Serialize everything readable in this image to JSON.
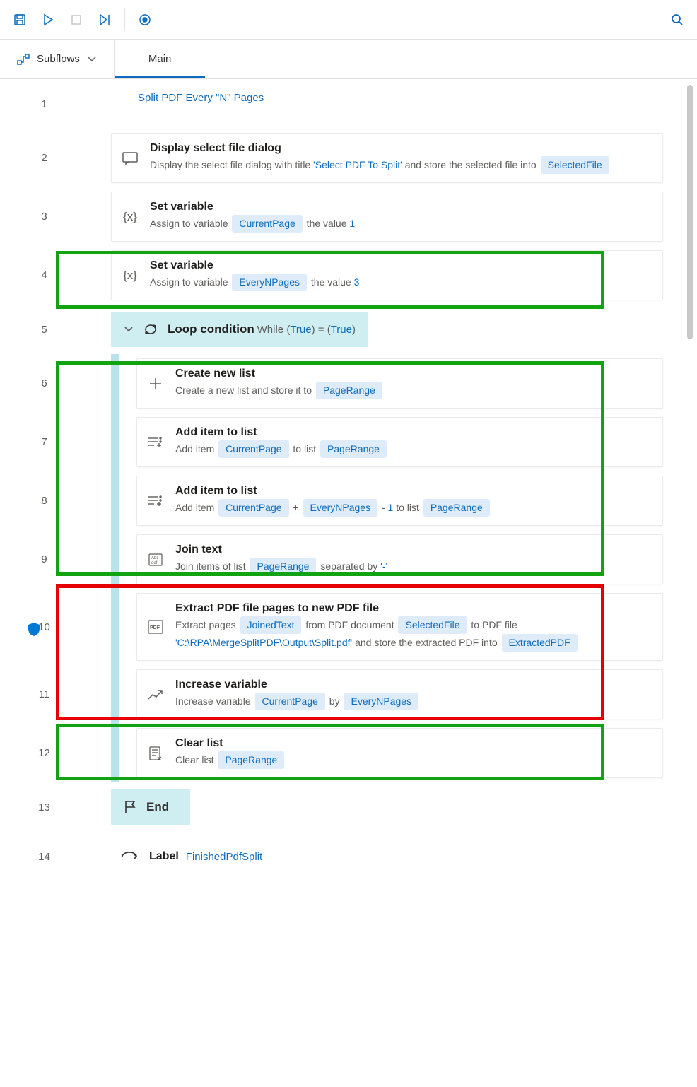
{
  "toolbar": {
    "save": "Save",
    "run": "Run",
    "stop": "Stop",
    "next": "Run next action",
    "record": "Recorder",
    "search": "Search"
  },
  "tabs": {
    "subflows_label": "Subflows",
    "main_label": "Main"
  },
  "flow": {
    "comment": "Split PDF Every \"N\" Pages",
    "steps": [
      {
        "n": 1
      },
      {
        "n": 2,
        "title": "Display select file dialog",
        "desc_pre": "Display the select file dialog with title ",
        "str1": "'Select PDF To Split'",
        "desc_mid": " and store the selected file into ",
        "tok1": "SelectedFile"
      },
      {
        "n": 3,
        "title": "Set variable",
        "desc_pre": "Assign to variable ",
        "tok1": "CurrentPage",
        "desc_mid": " the value ",
        "num1": "1"
      },
      {
        "n": 4,
        "title": "Set variable",
        "desc_pre": "Assign to variable ",
        "tok1": "EveryNPages",
        "desc_mid": " the value ",
        "num1": "3"
      },
      {
        "n": 5,
        "title": "Loop condition",
        "cond_pre": "While (",
        "cond_tok1": "True",
        "cond_mid": ") = (",
        "cond_tok2": "True",
        "cond_post": ")"
      },
      {
        "n": 6,
        "title": "Create new list",
        "desc_pre": "Create a new list and store it to ",
        "tok1": "PageRange"
      },
      {
        "n": 7,
        "title": "Add item to list",
        "desc_pre": "Add item ",
        "tok1": "CurrentPage",
        "desc_mid": " to list ",
        "tok2": "PageRange"
      },
      {
        "n": 8,
        "title": "Add item to list",
        "desc_pre": "Add item ",
        "tok1": "CurrentPage",
        "desc_mid": " + ",
        "tok2": "EveryNPages",
        "desc_mid2": " - ",
        "num1": "1",
        "desc_mid3": " to list ",
        "tok3": "PageRange"
      },
      {
        "n": 9,
        "title": "Join text",
        "desc_pre": "Join items of list ",
        "tok1": "PageRange",
        "desc_mid": " separated by ",
        "str1": "'-'"
      },
      {
        "n": 10,
        "title": "Extract PDF file pages to new PDF file",
        "desc_pre": "Extract pages ",
        "tok1": "JoinedText",
        "desc_mid": " from PDF document ",
        "tok2": "SelectedFile",
        "desc_mid2": " to PDF file ",
        "str1": "'C:\\RPA\\MergeSplitPDF\\Output\\Split.pdf'",
        "desc_mid3": " and store the extracted PDF into ",
        "tok3": "ExtractedPDF"
      },
      {
        "n": 11,
        "title": "Increase variable",
        "desc_pre": "Increase variable ",
        "tok1": "CurrentPage",
        "desc_mid": " by ",
        "tok2": "EveryNPages"
      },
      {
        "n": 12,
        "title": "Clear list",
        "desc_pre": "Clear list ",
        "tok1": "PageRange"
      },
      {
        "n": 13,
        "title": "End"
      },
      {
        "n": 14,
        "title": "Label",
        "label_name": "FinishedPdfSplit"
      }
    ]
  }
}
